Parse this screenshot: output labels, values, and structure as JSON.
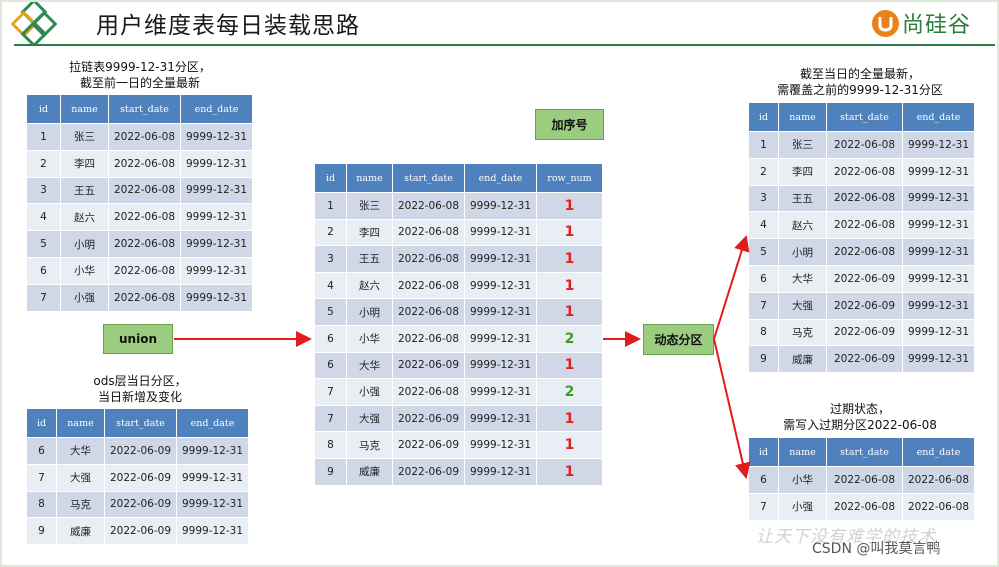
{
  "title": "用户维度表每日装载思路",
  "brand": {
    "name": "尚硅谷",
    "accent": "#e8821c",
    "text_color": "#2e7d3e"
  },
  "captions": {
    "left_top": [
      "拉链表9999-12-31分区，",
      "截至前一日的全量最新"
    ],
    "left_bottom": [
      "ods层当日分区，",
      "当日新增及变化"
    ],
    "right_top": [
      "截至当日的全量最新，",
      "需覆盖之前的9999-12-31分区"
    ],
    "right_bottom": [
      "过期状态，",
      "需写入过期分区2022-06-08"
    ]
  },
  "boxes": {
    "union": "union",
    "add_row_num": "加序号",
    "dynamic_partition": "动态分区"
  },
  "headers": {
    "base": [
      "id",
      "name",
      "start_date",
      "end_date"
    ],
    "middle": [
      "id",
      "name",
      "start_date",
      "end_date",
      "row_num"
    ]
  },
  "tables": {
    "zip_history": [
      [
        "1",
        "张三",
        "2022-06-08",
        "9999-12-31"
      ],
      [
        "2",
        "李四",
        "2022-06-08",
        "9999-12-31"
      ],
      [
        "3",
        "王五",
        "2022-06-08",
        "9999-12-31"
      ],
      [
        "4",
        "赵六",
        "2022-06-08",
        "9999-12-31"
      ],
      [
        "5",
        "小明",
        "2022-06-08",
        "9999-12-31"
      ],
      [
        "6",
        "小华",
        "2022-06-08",
        "9999-12-31"
      ],
      [
        "7",
        "小强",
        "2022-06-08",
        "9999-12-31"
      ]
    ],
    "ods_today": [
      [
        "6",
        "大华",
        "2022-06-09",
        "9999-12-31"
      ],
      [
        "7",
        "大强",
        "2022-06-09",
        "9999-12-31"
      ],
      [
        "8",
        "马克",
        "2022-06-09",
        "9999-12-31"
      ],
      [
        "9",
        "威廉",
        "2022-06-09",
        "9999-12-31"
      ]
    ],
    "with_row_num": [
      [
        "1",
        "张三",
        "2022-06-08",
        "9999-12-31",
        "1"
      ],
      [
        "2",
        "李四",
        "2022-06-08",
        "9999-12-31",
        "1"
      ],
      [
        "3",
        "王五",
        "2022-06-08",
        "9999-12-31",
        "1"
      ],
      [
        "4",
        "赵六",
        "2022-06-08",
        "9999-12-31",
        "1"
      ],
      [
        "5",
        "小明",
        "2022-06-08",
        "9999-12-31",
        "1"
      ],
      [
        "6",
        "小华",
        "2022-06-08",
        "9999-12-31",
        "2"
      ],
      [
        "6",
        "大华",
        "2022-06-09",
        "9999-12-31",
        "1"
      ],
      [
        "7",
        "小强",
        "2022-06-08",
        "9999-12-31",
        "2"
      ],
      [
        "7",
        "大强",
        "2022-06-09",
        "9999-12-31",
        "1"
      ],
      [
        "8",
        "马克",
        "2022-06-09",
        "9999-12-31",
        "1"
      ],
      [
        "9",
        "威廉",
        "2022-06-09",
        "9999-12-31",
        "1"
      ]
    ],
    "latest_full": [
      [
        "1",
        "张三",
        "2022-06-08",
        "9999-12-31"
      ],
      [
        "2",
        "李四",
        "2022-06-08",
        "9999-12-31"
      ],
      [
        "3",
        "王五",
        "2022-06-08",
        "9999-12-31"
      ],
      [
        "4",
        "赵六",
        "2022-06-08",
        "9999-12-31"
      ],
      [
        "5",
        "小明",
        "2022-06-08",
        "9999-12-31"
      ],
      [
        "6",
        "大华",
        "2022-06-09",
        "9999-12-31"
      ],
      [
        "7",
        "大强",
        "2022-06-09",
        "9999-12-31"
      ],
      [
        "8",
        "马克",
        "2022-06-09",
        "9999-12-31"
      ],
      [
        "9",
        "威廉",
        "2022-06-09",
        "9999-12-31"
      ]
    ],
    "expired": [
      [
        "6",
        "小华",
        "2022-06-08",
        "2022-06-08"
      ],
      [
        "7",
        "小强",
        "2022-06-08",
        "2022-06-08"
      ]
    ]
  },
  "watermark": "让天下没有难学的技术",
  "csdn_credit": "CSDN @叫我莫言鸭",
  "colors": {
    "header": "#4f81bd",
    "row_even": "#d0d8e8",
    "row_odd": "#e9edf4",
    "arrow": "#e01c1c",
    "green_box": "#9bcc7f",
    "rn_1": "#e0201c",
    "rn_2": "#3c9a2a"
  }
}
